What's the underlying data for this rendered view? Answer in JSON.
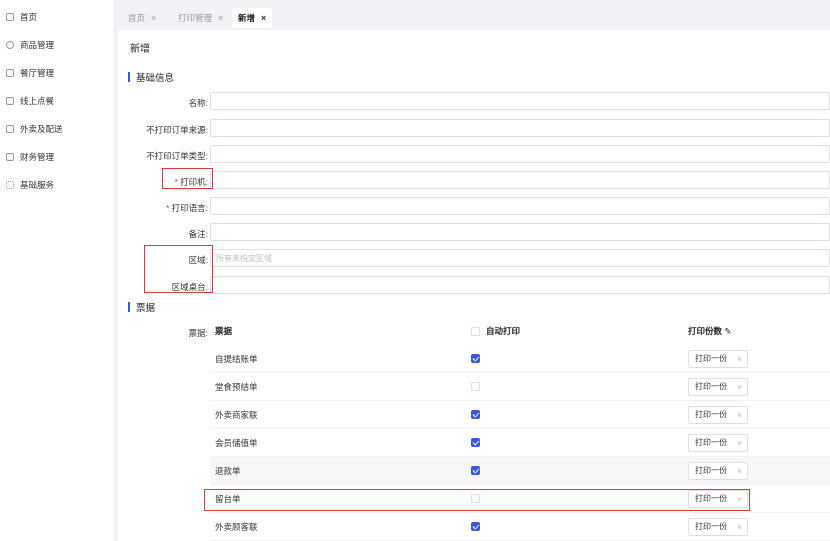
{
  "sidebar": {
    "items": [
      {
        "label": "首页",
        "icon": "home-icon"
      },
      {
        "label": "商品管理",
        "icon": "box-icon"
      },
      {
        "label": "餐厅管理",
        "icon": "store-icon"
      },
      {
        "label": "线上点餐",
        "icon": "order-icon"
      },
      {
        "label": "外卖及配送",
        "icon": "delivery-icon"
      },
      {
        "label": "财务管理",
        "icon": "wallet-icon"
      },
      {
        "label": "基础服务",
        "icon": "grid-icon"
      }
    ]
  },
  "tabs": [
    {
      "label": "首页",
      "close": "×"
    },
    {
      "label": "打印管理",
      "close": "×"
    },
    {
      "label": "新增",
      "close": "×"
    }
  ],
  "page": {
    "title": "新增"
  },
  "sections": {
    "basic": "基础信息",
    "tickets": "票据"
  },
  "form": {
    "name_label": "名称:",
    "exclude_source_label": "不打印订单来源:",
    "exclude_type_label": "不打印订单类型:",
    "printer_label": "打印机:",
    "language_label": "打印语言:",
    "remark_label": "备注:",
    "area_label": "区域:",
    "area_placeholder": "所有未指定区域",
    "area_table_label": "区域桌台:",
    "required_mark": "*"
  },
  "ticket_table": {
    "label": "票据:",
    "headers": {
      "ticket": "票据",
      "auto_print": "自动打印",
      "copies": "打印份数"
    },
    "rows": [
      {
        "name": "自提结账单",
        "auto": true,
        "copies": "打印一份"
      },
      {
        "name": "堂食预结单",
        "auto": false,
        "copies": "打印一份"
      },
      {
        "name": "外卖商家联",
        "auto": true,
        "copies": "打印一份"
      },
      {
        "name": "会员储值单",
        "auto": true,
        "copies": "打印一份"
      },
      {
        "name": "退款单",
        "auto": true,
        "copies": "打印一份"
      },
      {
        "name": "留台单",
        "auto": false,
        "copies": "打印一份"
      },
      {
        "name": "外卖顾客联",
        "auto": true,
        "copies": "打印一份"
      }
    ]
  },
  "colors": {
    "accent": "#3a56e4",
    "highlight": "#e53935"
  }
}
